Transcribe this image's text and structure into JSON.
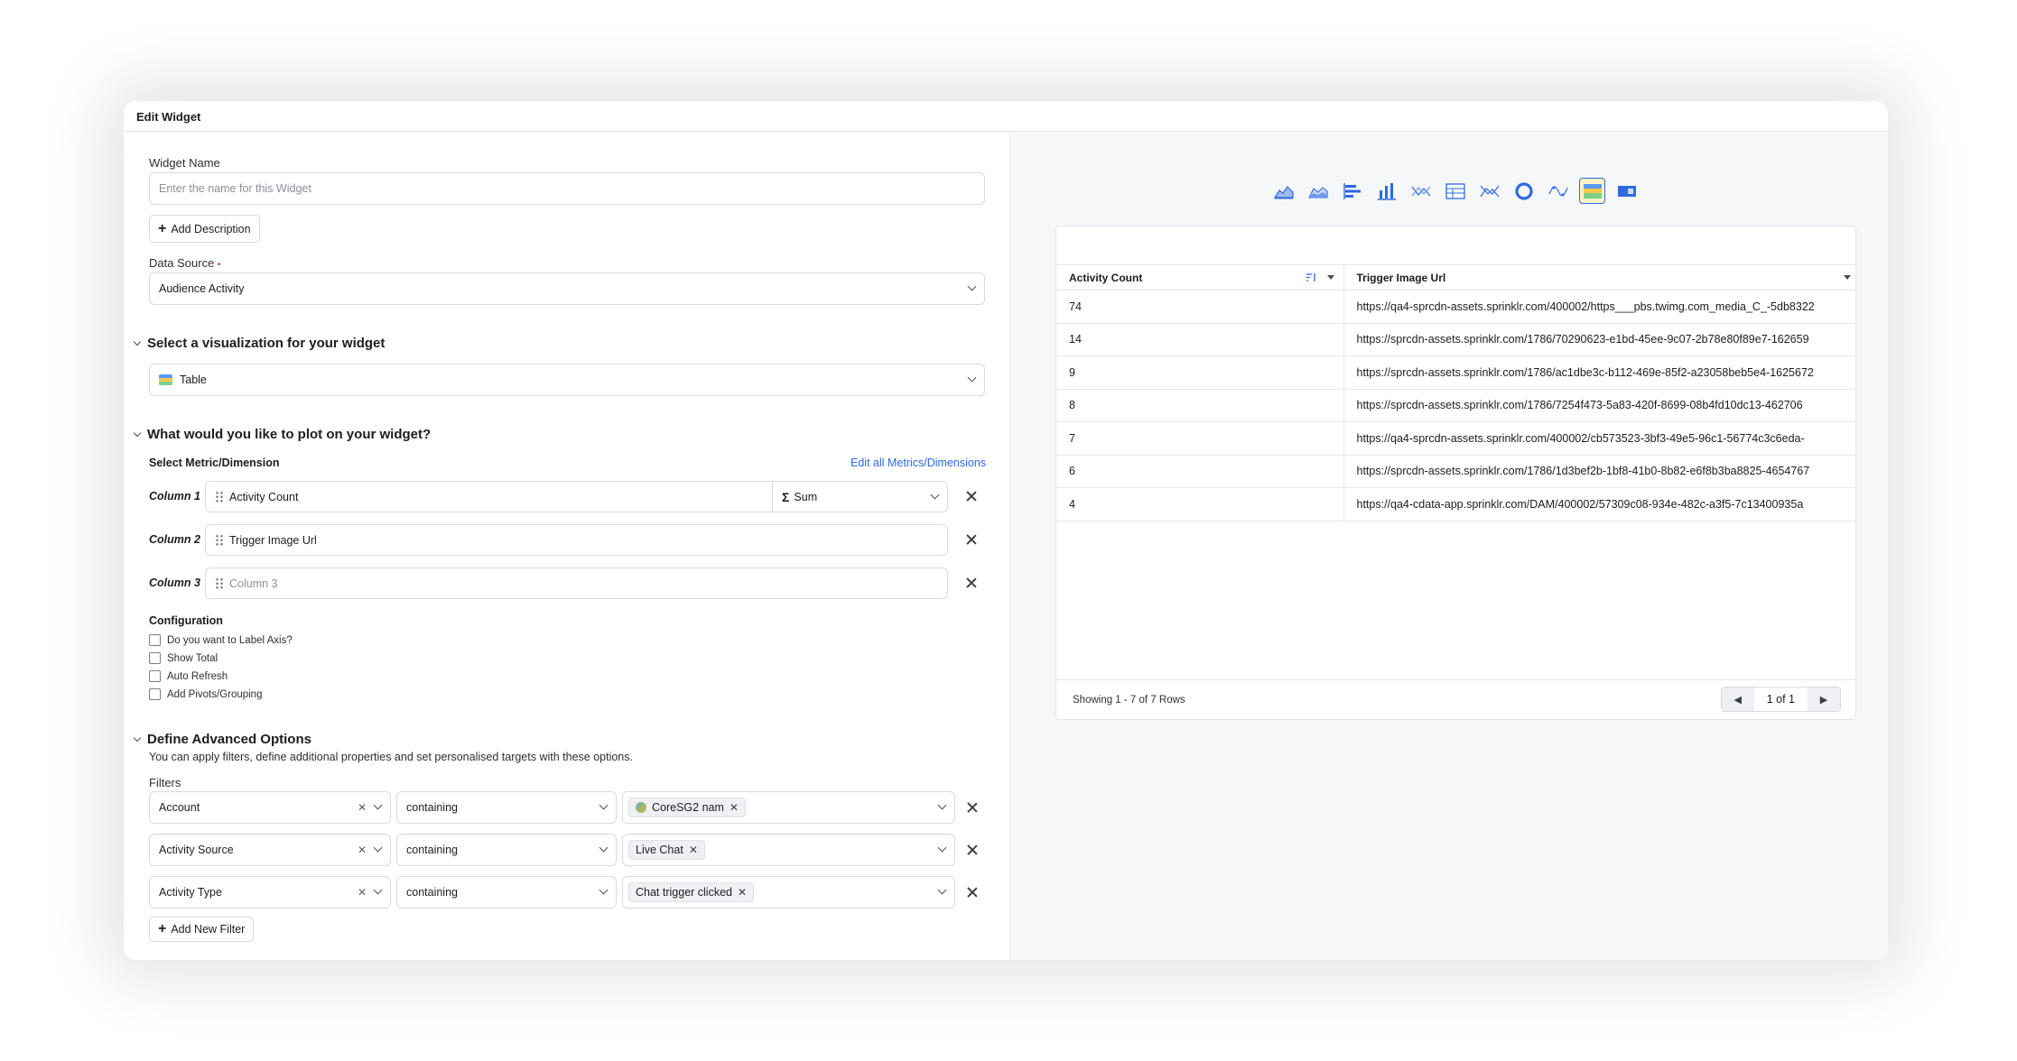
{
  "modal": {
    "title": "Edit Widget"
  },
  "form": {
    "widget_name": {
      "label": "Widget Name",
      "placeholder": "Enter the name for this Widget",
      "value": ""
    },
    "add_description_label": "Add Description",
    "data_source": {
      "label": "Data Source",
      "required_marker": "•",
      "value": "Audience Activity"
    }
  },
  "visualization": {
    "section_title": "Select a visualization for your widget",
    "selected": "Table"
  },
  "plot": {
    "section_title": "What would you like to plot on your widget?",
    "subhead": "Select Metric/Dimension",
    "edit_link": "Edit all Metrics/Dimensions",
    "columns": [
      {
        "label": "Column 1",
        "value": "Activity Count",
        "aggregation": "Sum",
        "agg_symbol": "Σ"
      },
      {
        "label": "Column 2",
        "value": "Trigger Image Url"
      },
      {
        "label": "Column 3",
        "placeholder": "Column 3"
      }
    ],
    "configuration": {
      "title": "Configuration",
      "options": [
        "Do you want to Label Axis?",
        "Show Total",
        "Auto Refresh",
        "Add Pivots/Grouping"
      ]
    }
  },
  "advanced": {
    "section_title": "Define Advanced Options",
    "description": "You can apply filters, define additional properties and set personalised targets with these options.",
    "filters_label": "Filters",
    "filters": [
      {
        "field": "Account",
        "operator": "containing",
        "value": "CoreSG2 nam"
      },
      {
        "field": "Activity Source",
        "operator": "containing",
        "value": "Live Chat"
      },
      {
        "field": "Activity Type",
        "operator": "containing",
        "value": "Chat trigger clicked"
      }
    ],
    "add_filter_label": "Add New Filter"
  },
  "preview": {
    "viz_icons": [
      "area-chart-icon",
      "stacked-area-icon",
      "bar-horizontal-icon",
      "column-chart-icon",
      "scatter-icon",
      "table-grid-icon",
      "line-scatter-icon",
      "donut-icon",
      "spline-icon",
      "table-icon",
      "card-icon"
    ],
    "active_icon": "table-icon",
    "table": {
      "headers": [
        "Activity Count",
        "Trigger Image Url"
      ],
      "rows": [
        [
          "74",
          "https://qa4-sprcdn-assets.sprinklr.com/400002/https___pbs.twimg.com_media_C_-5db8322"
        ],
        [
          "14",
          "https://sprcdn-assets.sprinklr.com/1786/70290623-e1bd-45ee-9c07-2b78e80f89e7-162659"
        ],
        [
          "9",
          "https://sprcdn-assets.sprinklr.com/1786/ac1dbe3c-b112-469e-85f2-a23058beb5e4-1625672"
        ],
        [
          "8",
          "https://sprcdn-assets.sprinklr.com/1786/7254f473-5a83-420f-8699-08b4fd10dc13-462706"
        ],
        [
          "7",
          "https://qa4-sprcdn-assets.sprinklr.com/400002/cb573523-3bf3-49e5-96c1-56774c3c6eda-"
        ],
        [
          "6",
          "https://sprcdn-assets.sprinklr.com/1786/1d3bef2b-1bf8-41b0-8b82-e6f8b3ba8825-4654767"
        ],
        [
          "4",
          "https://qa4-cdata-app.sprinklr.com/DAM/400002/57309c08-934e-482c-a3f5-7c13400935a"
        ]
      ],
      "footer_text": "Showing 1 - 7 of 7 Rows",
      "page_label": "1 of 1"
    }
  },
  "colors": {
    "accent": "#2d6ae3",
    "active_bg": "#fff3c5",
    "required": "#d0342c"
  }
}
